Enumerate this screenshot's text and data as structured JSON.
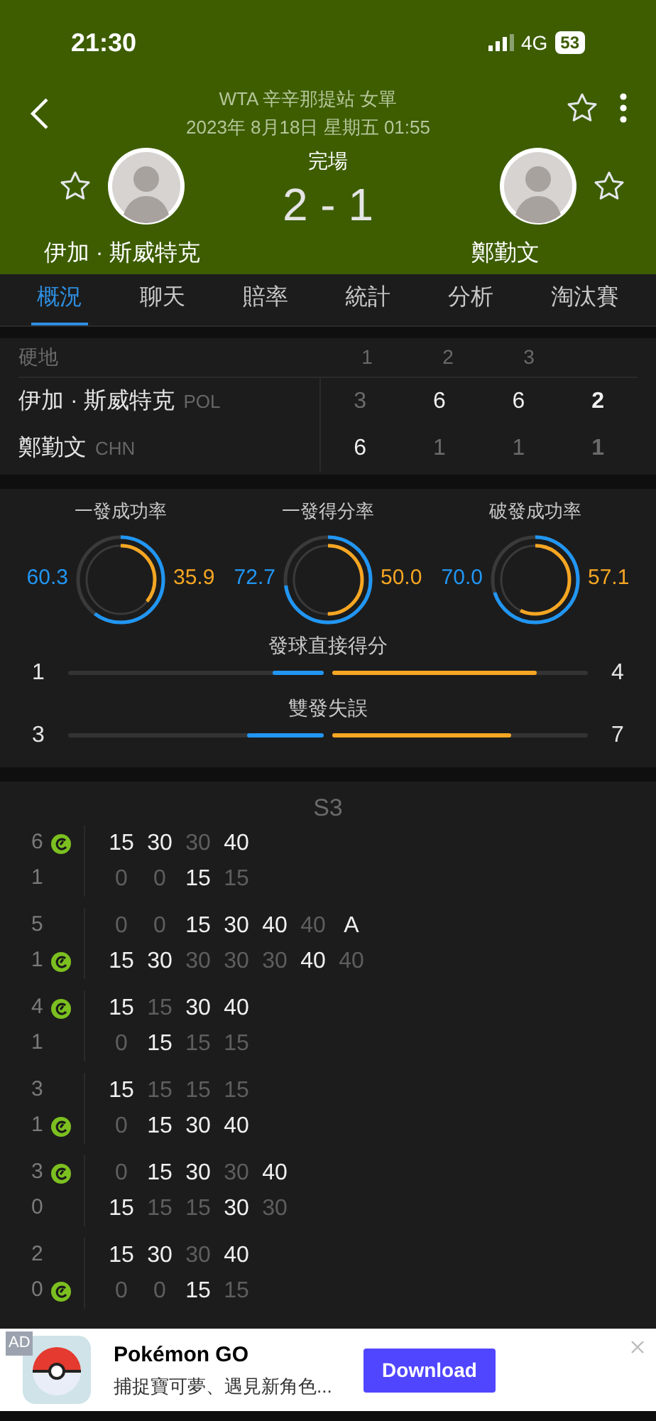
{
  "status_bar": {
    "time": "21:30",
    "network": "4G",
    "battery": "53"
  },
  "header": {
    "competition": "WTA 辛辛那提站 女單",
    "datetime": "2023年 8月18日 星期五 01:55",
    "status": "完場",
    "score": "2 - 1",
    "players": [
      {
        "name": "伊加 · 斯威特克"
      },
      {
        "name": "鄭勤文"
      }
    ]
  },
  "tabs": [
    {
      "label": "概況",
      "selected": true
    },
    {
      "label": "聊天",
      "selected": false
    },
    {
      "label": "賠率",
      "selected": false
    },
    {
      "label": "統計",
      "selected": false
    },
    {
      "label": "分析",
      "selected": false
    },
    {
      "label": "淘汰賽",
      "selected": false
    }
  ],
  "set_table": {
    "surface": "硬地",
    "columns": [
      "1",
      "2",
      "3"
    ],
    "rows": [
      {
        "name": "伊加 · 斯威特克",
        "country": "POL",
        "scores": [
          {
            "text": "3",
            "won": false
          },
          {
            "text": "6",
            "won": true
          },
          {
            "text": "6",
            "won": true
          },
          {
            "text": "2",
            "won": true
          }
        ]
      },
      {
        "name": "鄭勤文",
        "country": "CHN",
        "scores": [
          {
            "text": "6",
            "won": true
          },
          {
            "text": "1",
            "won": false
          },
          {
            "text": "1",
            "won": false
          },
          {
            "text": "1",
            "won": false
          }
        ]
      }
    ]
  },
  "rings": [
    {
      "title": "一發成功率",
      "left": {
        "value": "60.3",
        "level": 0.603
      },
      "right": {
        "value": "35.9",
        "level": 0.359
      }
    },
    {
      "title": "一發得分率",
      "left": {
        "value": "72.7",
        "level": 0.727
      },
      "right": {
        "value": "50.0",
        "level": 0.5
      }
    },
    {
      "title": "破發成功率",
      "left": {
        "value": "70.0",
        "level": 0.7
      },
      "right": {
        "value": "57.1",
        "level": 0.571
      }
    }
  ],
  "bars": [
    {
      "title": "發球直接得分",
      "left": {
        "value": "1",
        "level": 0.2
      },
      "right": {
        "value": "4",
        "level": 0.8
      }
    },
    {
      "title": "雙發失誤",
      "left": {
        "value": "3",
        "level": 0.3
      },
      "right": {
        "value": "7",
        "level": 0.7
      }
    }
  ],
  "points": {
    "set_label": "S3",
    "games": [
      {
        "rows": [
          {
            "games": "6",
            "serving": true,
            "points": [
              {
                "text": "15",
                "won": true
              },
              {
                "text": "30",
                "won": true
              },
              {
                "text": "30",
                "won": false
              },
              {
                "text": "40",
                "won": true
              }
            ]
          },
          {
            "games": "1",
            "serving": false,
            "points": [
              {
                "text": "0",
                "won": false
              },
              {
                "text": "0",
                "won": false
              },
              {
                "text": "15",
                "won": true
              },
              {
                "text": "15",
                "won": false
              }
            ]
          }
        ]
      },
      {
        "rows": [
          {
            "games": "5",
            "serving": false,
            "points": [
              {
                "text": "0",
                "won": false
              },
              {
                "text": "0",
                "won": false
              },
              {
                "text": "15",
                "won": true
              },
              {
                "text": "30",
                "won": true
              },
              {
                "text": "40",
                "won": true
              },
              {
                "text": "40",
                "won": false
              },
              {
                "text": "A",
                "won": true
              }
            ]
          },
          {
            "games": "1",
            "serving": true,
            "points": [
              {
                "text": "15",
                "won": true
              },
              {
                "text": "30",
                "won": true
              },
              {
                "text": "30",
                "won": false
              },
              {
                "text": "30",
                "won": false
              },
              {
                "text": "30",
                "won": false
              },
              {
                "text": "40",
                "won": true
              },
              {
                "text": "40",
                "won": false
              }
            ]
          }
        ]
      },
      {
        "rows": [
          {
            "games": "4",
            "serving": true,
            "points": [
              {
                "text": "15",
                "won": true
              },
              {
                "text": "15",
                "won": false
              },
              {
                "text": "30",
                "won": true
              },
              {
                "text": "40",
                "won": true
              }
            ]
          },
          {
            "games": "1",
            "serving": false,
            "points": [
              {
                "text": "0",
                "won": false
              },
              {
                "text": "15",
                "won": true
              },
              {
                "text": "15",
                "won": false
              },
              {
                "text": "15",
                "won": false
              }
            ]
          }
        ]
      },
      {
        "rows": [
          {
            "games": "3",
            "serving": false,
            "points": [
              {
                "text": "15",
                "won": true
              },
              {
                "text": "15",
                "won": false
              },
              {
                "text": "15",
                "won": false
              },
              {
                "text": "15",
                "won": false
              }
            ]
          },
          {
            "games": "1",
            "serving": true,
            "points": [
              {
                "text": "0",
                "won": false
              },
              {
                "text": "15",
                "won": true
              },
              {
                "text": "30",
                "won": true
              },
              {
                "text": "40",
                "won": true
              }
            ]
          }
        ]
      },
      {
        "rows": [
          {
            "games": "3",
            "serving": true,
            "points": [
              {
                "text": "0",
                "won": false
              },
              {
                "text": "15",
                "won": true
              },
              {
                "text": "30",
                "won": true
              },
              {
                "text": "30",
                "won": false
              },
              {
                "text": "40",
                "won": true
              }
            ]
          },
          {
            "games": "0",
            "serving": false,
            "points": [
              {
                "text": "15",
                "won": true
              },
              {
                "text": "15",
                "won": false
              },
              {
                "text": "15",
                "won": false
              },
              {
                "text": "30",
                "won": true
              },
              {
                "text": "30",
                "won": false
              }
            ]
          }
        ]
      },
      {
        "rows": [
          {
            "games": "2",
            "serving": false,
            "points": [
              {
                "text": "15",
                "won": true
              },
              {
                "text": "30",
                "won": true
              },
              {
                "text": "30",
                "won": false
              },
              {
                "text": "40",
                "won": true
              }
            ]
          },
          {
            "games": "0",
            "serving": true,
            "points": [
              {
                "text": "0",
                "won": false
              },
              {
                "text": "0",
                "won": false
              },
              {
                "text": "15",
                "won": true
              },
              {
                "text": "15",
                "won": false
              }
            ]
          }
        ]
      }
    ]
  },
  "ad": {
    "badge": "AD",
    "title": "Pokémon GO",
    "subtitle": "捕捉寶可夢、遇見新角色...",
    "button": "Download"
  }
}
